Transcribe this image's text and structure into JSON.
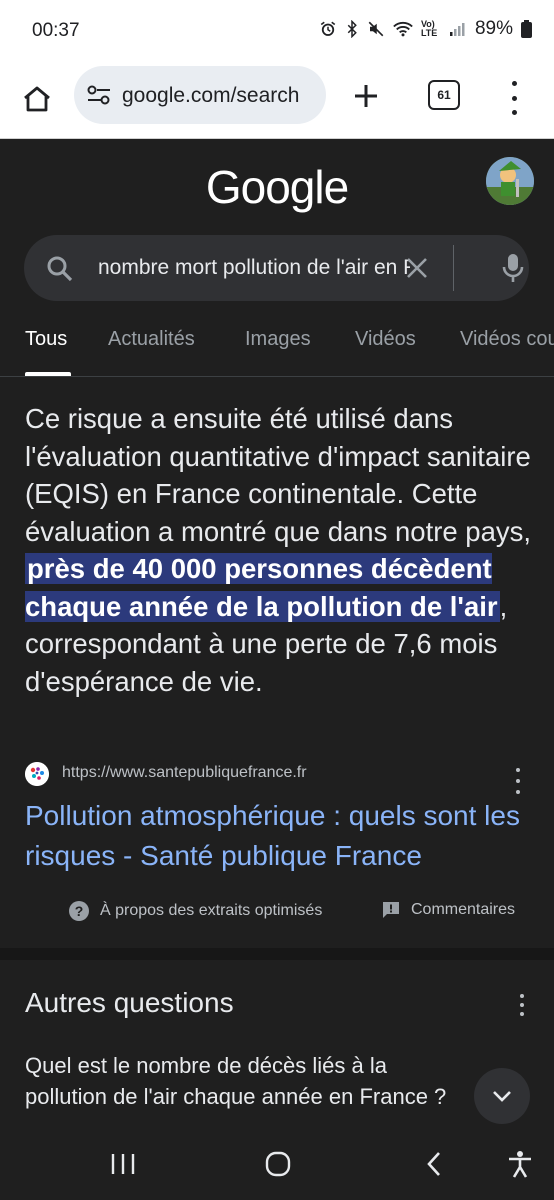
{
  "status_bar": {
    "time": "00:37",
    "network_label": "Vo) LTE",
    "battery_percent": "89%"
  },
  "browser": {
    "url": "google.com/search",
    "tab_count": "61"
  },
  "google": {
    "logo_text": "Google",
    "search_query": "nombre mort pollution de l'air en France"
  },
  "tabs": [
    {
      "label": "Tous",
      "active": true
    },
    {
      "label": "Actualités"
    },
    {
      "label": "Images"
    },
    {
      "label": "Vidéos"
    },
    {
      "label": "Vidéos courtes"
    }
  ],
  "featured_snippet": {
    "text_before": "Ce risque a ensuite été utilisé dans l'évaluation quantitative d'impact sanitaire (EQIS) en France continentale. Cette évaluation a montré que dans notre pays, ",
    "highlight": "près de 40 000 personnes décèdent chaque année de la pollution de l'air",
    "text_after": ", correspondant à une perte de 7,6 mois d'espérance de vie.",
    "source_url": "https://www.santepubliquefrance.fr",
    "title": "Pollution atmosphérique : quels sont les risques - Santé publique France",
    "about_label": "À propos des extraits optimisés",
    "feedback_label": "Commentaires"
  },
  "other_questions": {
    "title": "Autres questions",
    "first_question": "Quel est le nombre de décès liés à la pollution de l'air chaque année en France ?"
  },
  "colors": {
    "background": "#1f1f1f",
    "link": "#8ab4f8",
    "highlight": "#2c3a7c",
    "search_box": "#303134"
  }
}
